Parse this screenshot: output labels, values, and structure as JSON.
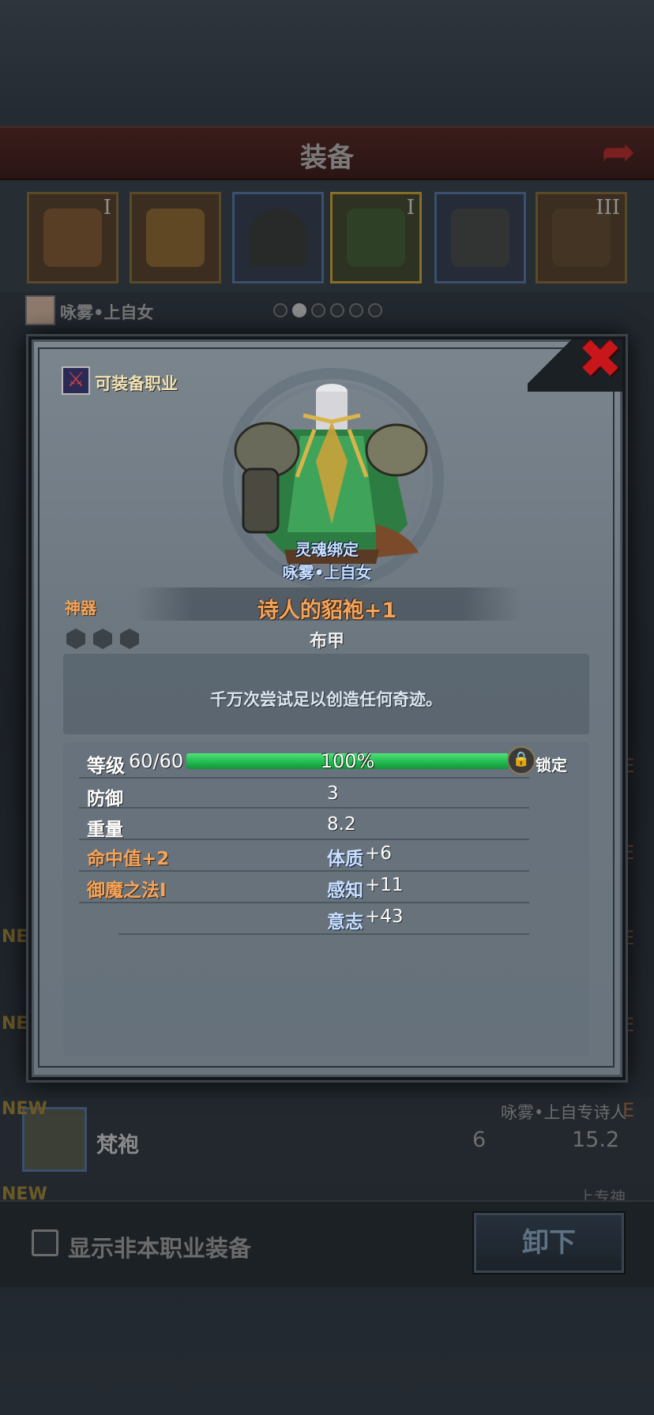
{
  "header": {
    "title": "装备"
  },
  "slots": [
    {
      "roman": "I"
    },
    {
      "roman": ""
    },
    {
      "roman": ""
    },
    {
      "roman": "I"
    },
    {
      "roman": ""
    },
    {
      "roman": "III"
    }
  ],
  "character": {
    "name": "咏雾•上自女"
  },
  "pagination": {
    "total": 6,
    "active": 1
  },
  "background_list": {
    "new_badge": "NEW",
    "edge_letter": "E",
    "row": {
      "name": "梵袍",
      "class": "咏雾•上自专诗人",
      "defense": "6",
      "weight": "15.2"
    },
    "next_row_class": "上专神"
  },
  "bottom": {
    "checkbox_label": "显示非本职业装备",
    "checkbox_checked": false,
    "unequip_label": "卸下"
  },
  "modal": {
    "class_label": "可装备职业",
    "soulbound": "灵魂绑定",
    "bound_owner": "咏雾•上自女",
    "rarity": "神器",
    "item_name": "诗人的貂袍+1",
    "item_type": "布甲",
    "socket_count": 3,
    "flavor": "千万次尝试足以创造任何奇迹。",
    "level": {
      "label": "等级",
      "value": "60/60",
      "progress_text": "100%",
      "progress": 1.0,
      "lock_label": "锁定"
    },
    "stats": {
      "defense": {
        "label": "防御",
        "value": "3"
      },
      "weight": {
        "label": "重量",
        "value": "8.2"
      },
      "hit": "命中值+2",
      "magic_resist": "御魔之法I",
      "constitution": {
        "label": "体质",
        "value": "+6"
      },
      "perception": {
        "label": "感知",
        "value": "+11"
      },
      "will": {
        "label": "意志",
        "value": "+43"
      }
    }
  },
  "colors": {
    "rarity_orange": "#f3a45c",
    "bound_blue": "#c9e0ff",
    "exp_green": "#1fb64c",
    "close_red": "#c8171a"
  },
  "icons": [
    "back-arrow-icon",
    "close-icon",
    "class-badge-icon",
    "lock-icon",
    "socket-hex-icon"
  ]
}
